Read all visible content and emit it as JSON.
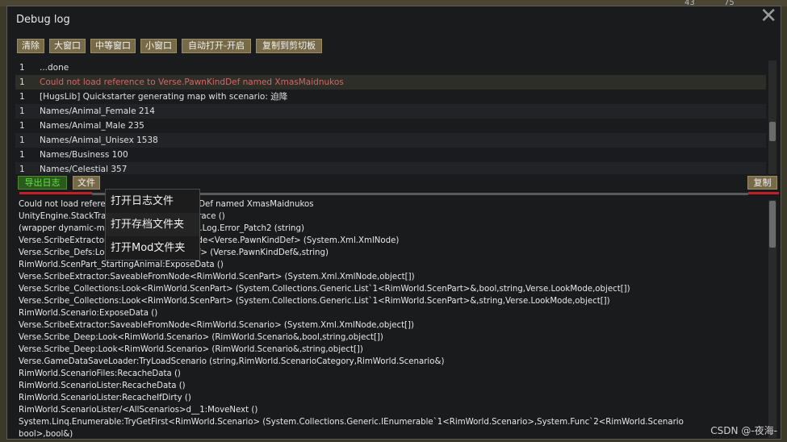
{
  "background": {
    "numbers": [
      "43",
      "75"
    ]
  },
  "window": {
    "title": "Debug log",
    "close_glyph": "✕"
  },
  "toolbar": {
    "buttons": [
      {
        "label": "清除"
      },
      {
        "label": "大窗口"
      },
      {
        "label": "中等窗口"
      },
      {
        "label": "小窗口"
      },
      {
        "label": "自动打开-开启"
      },
      {
        "label": "复制到剪切板"
      }
    ]
  },
  "log": {
    "rows": [
      {
        "count": "1",
        "message": "...done",
        "type": "normal"
      },
      {
        "count": "1",
        "message": "Could not load reference to Verse.PawnKindDef named XmasMaidnukos",
        "type": "error"
      },
      {
        "count": "1",
        "message": "[HugsLib] Quickstarter generating map with scenario: 迫降",
        "type": "normal"
      },
      {
        "count": "1",
        "message": "Names/Animal_Female 214",
        "type": "normal"
      },
      {
        "count": "1",
        "message": "Names/Animal_Male 235",
        "type": "normal"
      },
      {
        "count": "1",
        "message": "Names/Animal_Unisex 1538",
        "type": "normal"
      },
      {
        "count": "1",
        "message": "Names/Business 100",
        "type": "normal"
      },
      {
        "count": "1",
        "message": "Names/Celestial 357",
        "type": "normal"
      }
    ]
  },
  "actions": {
    "export_label": "导出日志",
    "file_label": "文件",
    "copy_label": "复制"
  },
  "file_menu": {
    "items": [
      "打开日志文件",
      "打开存档文件夹",
      "打开Mod文件夹"
    ]
  },
  "detail": {
    "lines": [
      "Could not load reference to Verse.PawnKindDef named XmasMaidnukos",
      "UnityEngine.StackTraceUtility:ExtractStackTrace ()",
      "(wrapper dynamic-method) Verse.Log:Verse.Log.Error_Patch2 (string)",
      "Verse.ScribeExtractor:DefReferenceFromNode<Verse.PawnKindDef> (System.Xml.XmlNode)",
      "Verse.Scribe_Defs:Look<Verse.PawnKindDef> (Verse.PawnKindDef&,string)",
      "RimWorld.ScenPart_StartingAnimal:ExposeData ()",
      "Verse.ScribeExtractor:SaveableFromNode<RimWorld.ScenPart> (System.Xml.XmlNode,object[])",
      "Verse.Scribe_Collections:Look<RimWorld.ScenPart> (System.Collections.Generic.List`1<RimWorld.ScenPart>&,bool,string,Verse.LookMode,object[])",
      "Verse.Scribe_Collections:Look<RimWorld.ScenPart> (System.Collections.Generic.List`1<RimWorld.ScenPart>&,string,Verse.LookMode,object[])",
      "RimWorld.Scenario:ExposeData ()",
      "Verse.ScribeExtractor:SaveableFromNode<RimWorld.Scenario> (System.Xml.XmlNode,object[])",
      "Verse.Scribe_Deep:Look<RimWorld.Scenario> (RimWorld.Scenario&,bool,string,object[])",
      "Verse.Scribe_Deep:Look<RimWorld.Scenario> (RimWorld.Scenario&,string,object[])",
      "Verse.GameDataSaveLoader:TryLoadScenario (string,RimWorld.ScenarioCategory,RimWorld.Scenario&)",
      "RimWorld.ScenarioFiles:RecacheData ()",
      "RimWorld.ScenarioLister:RecacheData ()",
      "RimWorld.ScenarioLister:RecacheIfDirty ()",
      "RimWorld.ScenarioLister/<AllScenarios>d__1:MoveNext ()",
      "System.Linq.Enumerable:TryGetFirst<RimWorld.Scenario> (System.Collections.Generic.IEnumerable`1<RimWorld.Scenario>,System.Func`2<RimWorld.Scenario",
      "bool>,bool&)"
    ]
  },
  "watermark": "CSDN @-夜海-"
}
